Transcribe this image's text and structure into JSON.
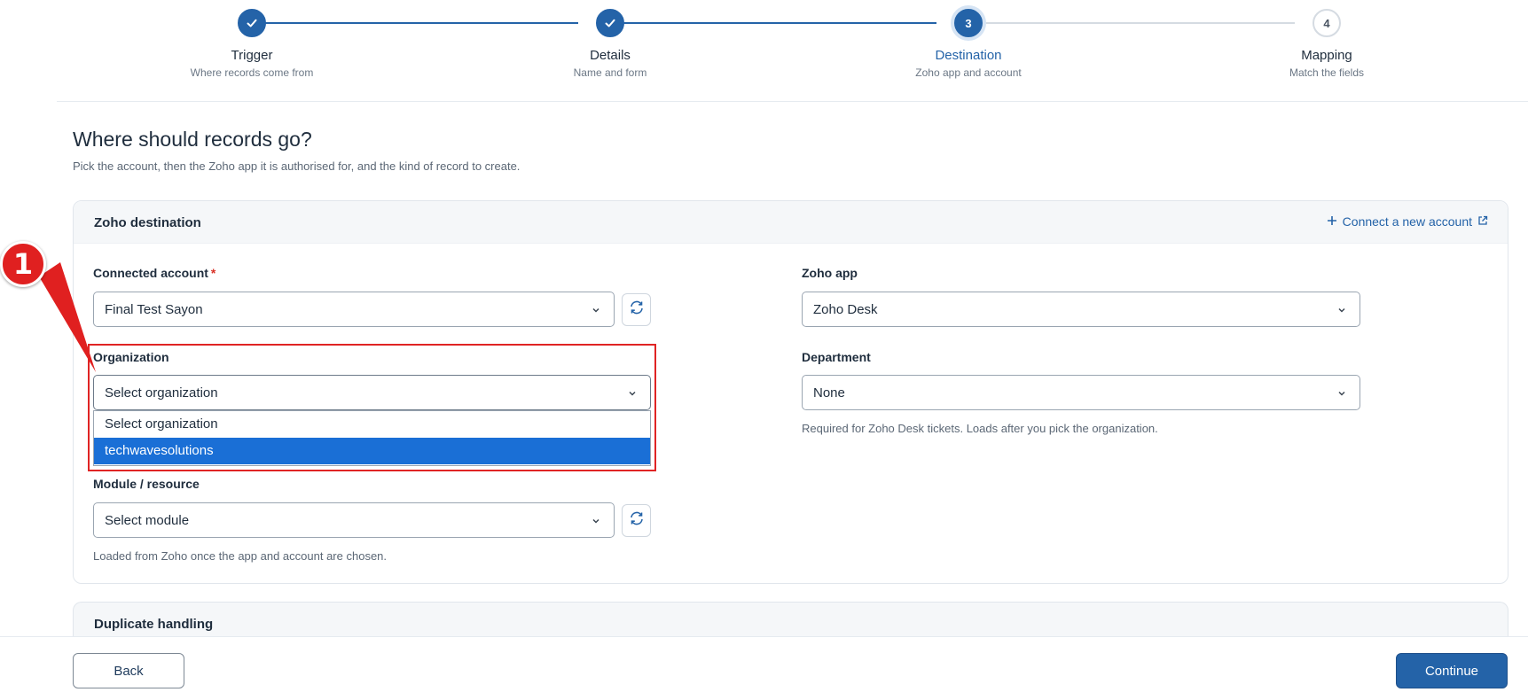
{
  "stepper": {
    "steps": [
      {
        "number": "1",
        "title": "Trigger",
        "subtitle": "Where records come from",
        "status": "done"
      },
      {
        "number": "2",
        "title": "Details",
        "subtitle": "Name and form",
        "status": "done"
      },
      {
        "number": "3",
        "title": "Destination",
        "subtitle": "Zoho app and account",
        "status": "current"
      },
      {
        "number": "4",
        "title": "Mapping",
        "subtitle": "Match the fields",
        "status": "todo"
      }
    ]
  },
  "page": {
    "title": "Where should records go?",
    "description": "Pick the account, then the Zoho app it is authorised for, and the kind of record to create."
  },
  "destination_card": {
    "title": "Zoho destination",
    "connect_link": "Connect a new account",
    "connected_account": {
      "label": "Connected account",
      "required_mark": "*",
      "value": "Final Test Sayon"
    },
    "organization": {
      "label": "Organization",
      "value": "Select organization",
      "options": [
        "Select organization",
        "techwavesolutions"
      ],
      "highlighted_option": "techwavesolutions"
    },
    "module": {
      "label": "Module / resource",
      "value": "Select module",
      "hint": "Loaded from Zoho once the app and account are chosen."
    },
    "zoho_app": {
      "label": "Zoho app",
      "value": "Zoho Desk"
    },
    "department": {
      "label": "Department",
      "value": "None",
      "hint": "Required for Zoho Desk tickets. Loads after you pick the organization."
    }
  },
  "duplicate_card": {
    "title": "Duplicate handling"
  },
  "footer": {
    "back_label": "Back",
    "continue_label": "Continue"
  },
  "annotation": {
    "marker_label": "1"
  },
  "colors": {
    "accent": "#2463a8",
    "annotation": "#e02424",
    "selected_option": "#1a6fd6"
  },
  "icons": {
    "done": "check-icon",
    "dropdown": "chevron-down-icon",
    "refresh": "refresh-icon",
    "add": "plus-icon",
    "external": "external-link-icon"
  }
}
